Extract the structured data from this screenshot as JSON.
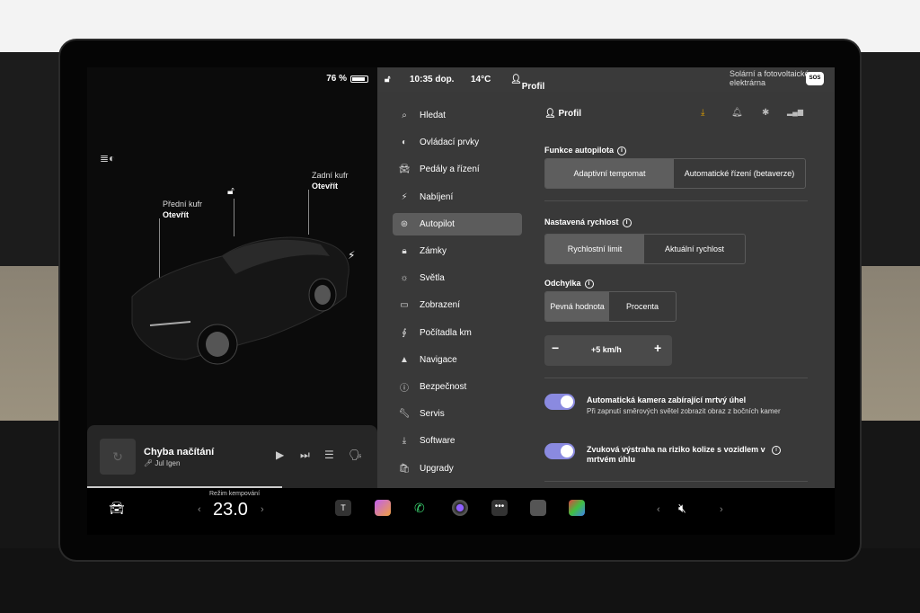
{
  "status": {
    "battery": "76 %",
    "time": "10:35 dop.",
    "temperature": "14°C",
    "profile": "Profil",
    "location": "Solární a fotovoltaické elektrárna",
    "sos": "SOS"
  },
  "car": {
    "front_trunk_label": "Přední kufr",
    "front_trunk_action": "Otevřít",
    "rear_trunk_label": "Zadní kufr",
    "rear_trunk_action": "Otevřít"
  },
  "media": {
    "title": "Chyba načítání",
    "subtitle": "Jul Igen"
  },
  "menu": {
    "items": [
      {
        "label": "Hledat",
        "icon": "search-icon"
      },
      {
        "label": "Ovládací prvky",
        "icon": "toggle-icon"
      },
      {
        "label": "Pedály a řízení",
        "icon": "car-icon"
      },
      {
        "label": "Nabíjení",
        "icon": "bolt-icon"
      },
      {
        "label": "Autopilot",
        "icon": "steering-wheel-icon",
        "active": true
      },
      {
        "label": "Zámky",
        "icon": "lock-icon"
      },
      {
        "label": "Světla",
        "icon": "sun-icon"
      },
      {
        "label": "Zobrazení",
        "icon": "display-icon"
      },
      {
        "label": "Počítadla km",
        "icon": "odometer-icon"
      },
      {
        "label": "Navigace",
        "icon": "navigation-icon"
      },
      {
        "label": "Bezpečnost",
        "icon": "info-icon"
      },
      {
        "label": "Servis",
        "icon": "wrench-icon"
      },
      {
        "label": "Software",
        "icon": "download-icon"
      },
      {
        "label": "Upgrady",
        "icon": "bag-icon"
      }
    ]
  },
  "content": {
    "profile": "Profil",
    "autopilot_heading": "Funkce autopilota",
    "autopilot_options": [
      "Adaptivní tempomat",
      "Automatické řízení (betaverze)"
    ],
    "speed_heading": "Nastavená rychlost",
    "speed_options": [
      "Rychlostní limit",
      "Aktuální rychlost"
    ],
    "offset_heading": "Odchylka",
    "offset_options": [
      "Pevná hodnota",
      "Procenta"
    ],
    "offset_value": "+5 km/h",
    "stepper_minus": "−",
    "stepper_plus": "+",
    "toggle1_title": "Automatická kamera zabírající mrtvý úhel",
    "toggle1_sub": "Při zapnutí směrových světel zobrazit obraz z bočních kamer",
    "toggle2_title": "Zvuková výstraha na riziko kolize s vozidlem v mrtvém úhlu"
  },
  "dock": {
    "climate_label": "Režim kempování",
    "temperature": "23.0"
  },
  "colors": {
    "accent": "#8a8ae0",
    "panel": "#393939",
    "active": "#5c5c5c"
  }
}
